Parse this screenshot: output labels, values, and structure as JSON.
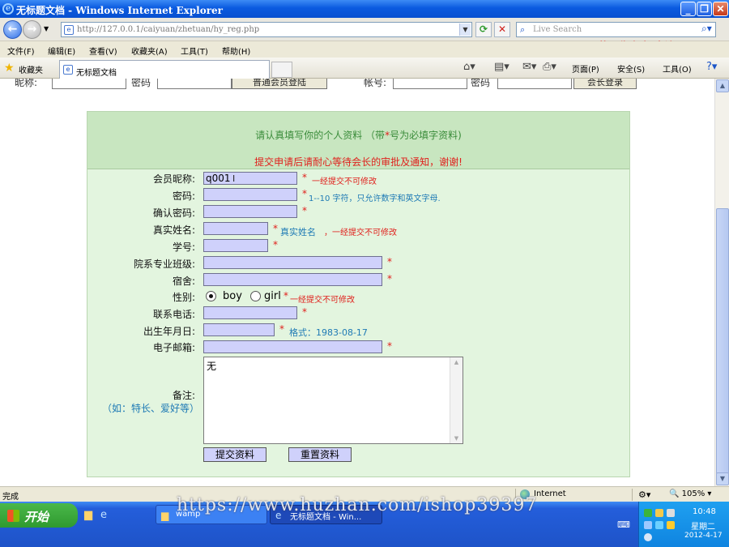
{
  "window": {
    "title": "无标题文档 - Windows Internet Explorer",
    "overlay_watermark": "屏幕录像专家 未注册"
  },
  "address": {
    "url": "http://127.0.0.1/caiyuan/zhetuan/hy_reg.php",
    "search_placeholder": "Live Search"
  },
  "menu": [
    "文件(F)",
    "编辑(E)",
    "查看(V)",
    "收藏夹(A)",
    "工具(T)",
    "帮助(H)"
  ],
  "favbar": {
    "favorites_label": "收藏夹",
    "tab_title": "无标题文档",
    "page_menu": "页面(P)",
    "safety_menu": "安全(S)",
    "tools_menu": "工具(O)"
  },
  "login": {
    "nickname_label": "昵称:",
    "password_label": "密码",
    "normal_login": "普通会员登陆",
    "account_label": "帐号:",
    "password2_label": "密码",
    "leader_login": "会长登录"
  },
  "form": {
    "header_line1_pre": "请认真填写你的个人资料 （带",
    "header_star": "*",
    "header_line1_post": "号为必填字资料)",
    "header_line2": "提交申请后请耐心等待会长的审批及通知，谢谢!",
    "required_mark": "*",
    "fields": {
      "nickname": {
        "label": "会员昵称:",
        "value": "q001",
        "note": "一经提交不可修改"
      },
      "password": {
        "label": "密码:",
        "value": "",
        "note": "1--10 字符，只允许数字和英文字母."
      },
      "confirm": {
        "label": "确认密码:",
        "value": ""
      },
      "realname": {
        "label": "真实姓名:",
        "value": "",
        "note_a": "真实姓名",
        "note_b": "，一经提交不可修改"
      },
      "student_id": {
        "label": "学号:",
        "value": ""
      },
      "department": {
        "label": "院系专业班级:",
        "value": ""
      },
      "dorm": {
        "label": "宿舍:",
        "value": ""
      },
      "gender": {
        "label": "性别:",
        "options": [
          "boy",
          "girl"
        ],
        "selected": "boy",
        "note": "一经提交不可修改"
      },
      "phone": {
        "label": "联系电话:",
        "value": ""
      },
      "birthday": {
        "label": "出生年月日:",
        "value": "",
        "note": "格式：1983-08-17"
      },
      "email": {
        "label": "电子邮箱:",
        "value": ""
      },
      "remarks": {
        "label": "备注:",
        "hint": "（如：特长、爱好等）",
        "value": "无"
      }
    },
    "submit_label": "提交资料",
    "reset_label": "重置资料"
  },
  "status": {
    "left": "完成",
    "zone": "Internet",
    "zoom": "105%"
  },
  "taskbar": {
    "start_label": "开始",
    "tasks": [
      "wamp",
      "无标题文档 - Win..."
    ],
    "time": "10:48",
    "day": "星期二",
    "date": "2012-4-17"
  },
  "screen_watermark": "https://www.huzhan.com/ishop39397"
}
